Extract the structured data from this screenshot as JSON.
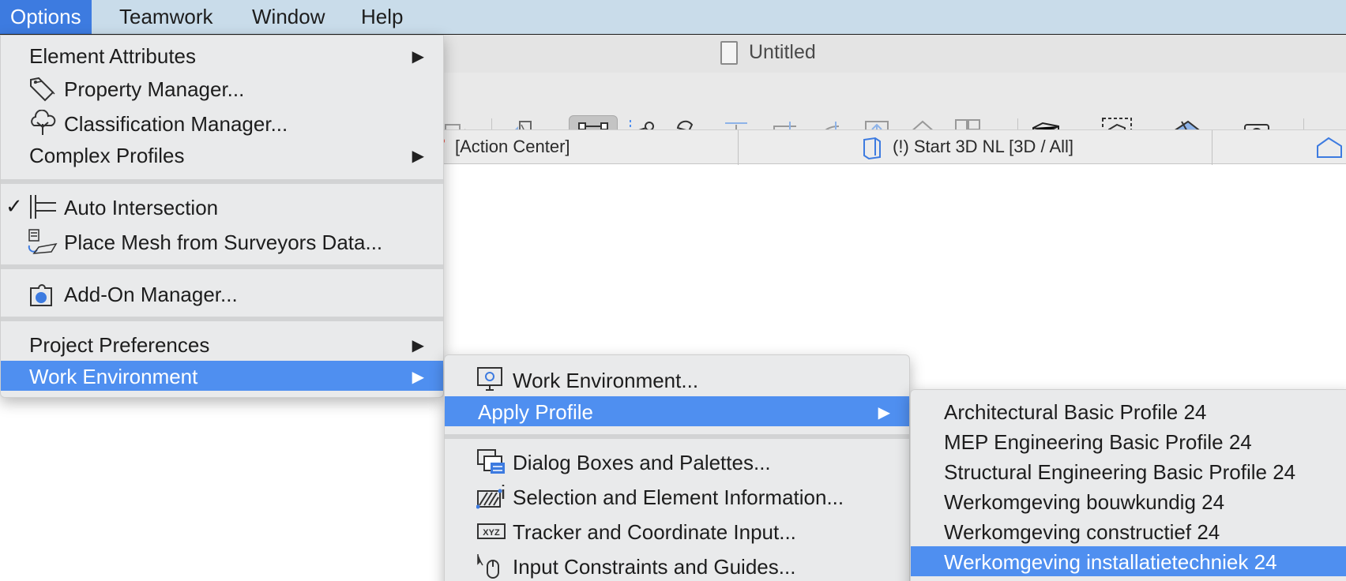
{
  "menubar": {
    "items": [
      {
        "label": "Options",
        "active": true
      },
      {
        "label": "Teamwork",
        "active": false
      },
      {
        "label": "Window",
        "active": false
      },
      {
        "label": "Help",
        "active": false
      }
    ]
  },
  "window": {
    "title": "Untitled",
    "tabs": {
      "action_center": "[Action Center]",
      "view_3d": "(!) Start 3D NL [3D / All]"
    }
  },
  "options_menu": {
    "element_attributes": "Element Attributes",
    "property_manager": "Property Manager...",
    "classification_manager": "Classification Manager...",
    "complex_profiles": "Complex Profiles",
    "auto_intersection": "Auto Intersection",
    "auto_intersection_check": "✓",
    "place_mesh": "Place Mesh from Surveyors Data...",
    "addon_manager": "Add-On Manager...",
    "project_preferences": "Project Preferences",
    "work_environment": "Work Environment",
    "submenu_arrow": "▶"
  },
  "work_env_menu": {
    "work_environment": "Work Environment...",
    "apply_profile": "Apply Profile",
    "dialog_boxes": "Dialog Boxes and Palettes...",
    "selection_info": "Selection and Element Information...",
    "tracker": "Tracker and Coordinate Input...",
    "input_constraints": "Input Constraints and Guides..."
  },
  "profiles_menu": {
    "items": [
      "Architectural Basic Profile 24",
      "MEP Engineering Basic Profile 24",
      "Structural Engineering Basic Profile 24",
      "Werkomgeving bouwkundig 24",
      "Werkomgeving constructief 24",
      "Werkomgeving installatietechniek 24"
    ]
  },
  "colors": {
    "highlight": "#4f8ff0",
    "menubar_active": "#3d7be0",
    "menubar_bg": "#c9dcea",
    "menu_bg": "#e9eaeb"
  }
}
